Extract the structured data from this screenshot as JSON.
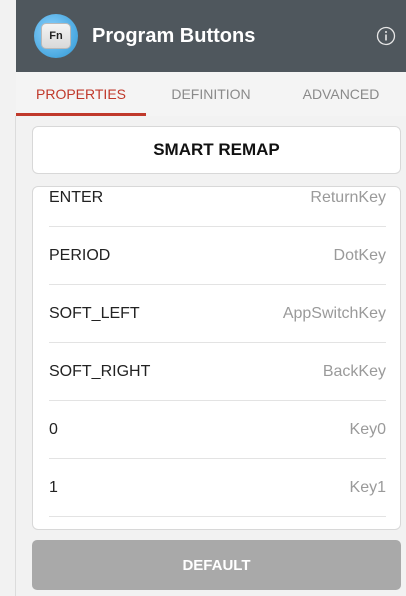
{
  "appbar": {
    "icon_label": "Fn",
    "title": "Program Buttons",
    "info_icon": "info-icon"
  },
  "tabs": [
    {
      "label": "PROPERTIES",
      "active": true
    },
    {
      "label": "DEFINITION",
      "active": false
    },
    {
      "label": "ADVANCED",
      "active": false
    }
  ],
  "smart_remap": {
    "label": "SMART REMAP"
  },
  "mappings": [
    {
      "key": "ENTER",
      "value": "ReturnKey"
    },
    {
      "key": "PERIOD",
      "value": "DotKey"
    },
    {
      "key": "SOFT_LEFT",
      "value": "AppSwitchKey"
    },
    {
      "key": "SOFT_RIGHT",
      "value": "BackKey"
    },
    {
      "key": "0",
      "value": "Key0"
    },
    {
      "key": "1",
      "value": "Key1"
    }
  ],
  "default_button": {
    "label": "DEFAULT"
  },
  "colors": {
    "appbar": "#4f575d",
    "accent": "#c0392b",
    "default_button": "#a9a9a9"
  }
}
